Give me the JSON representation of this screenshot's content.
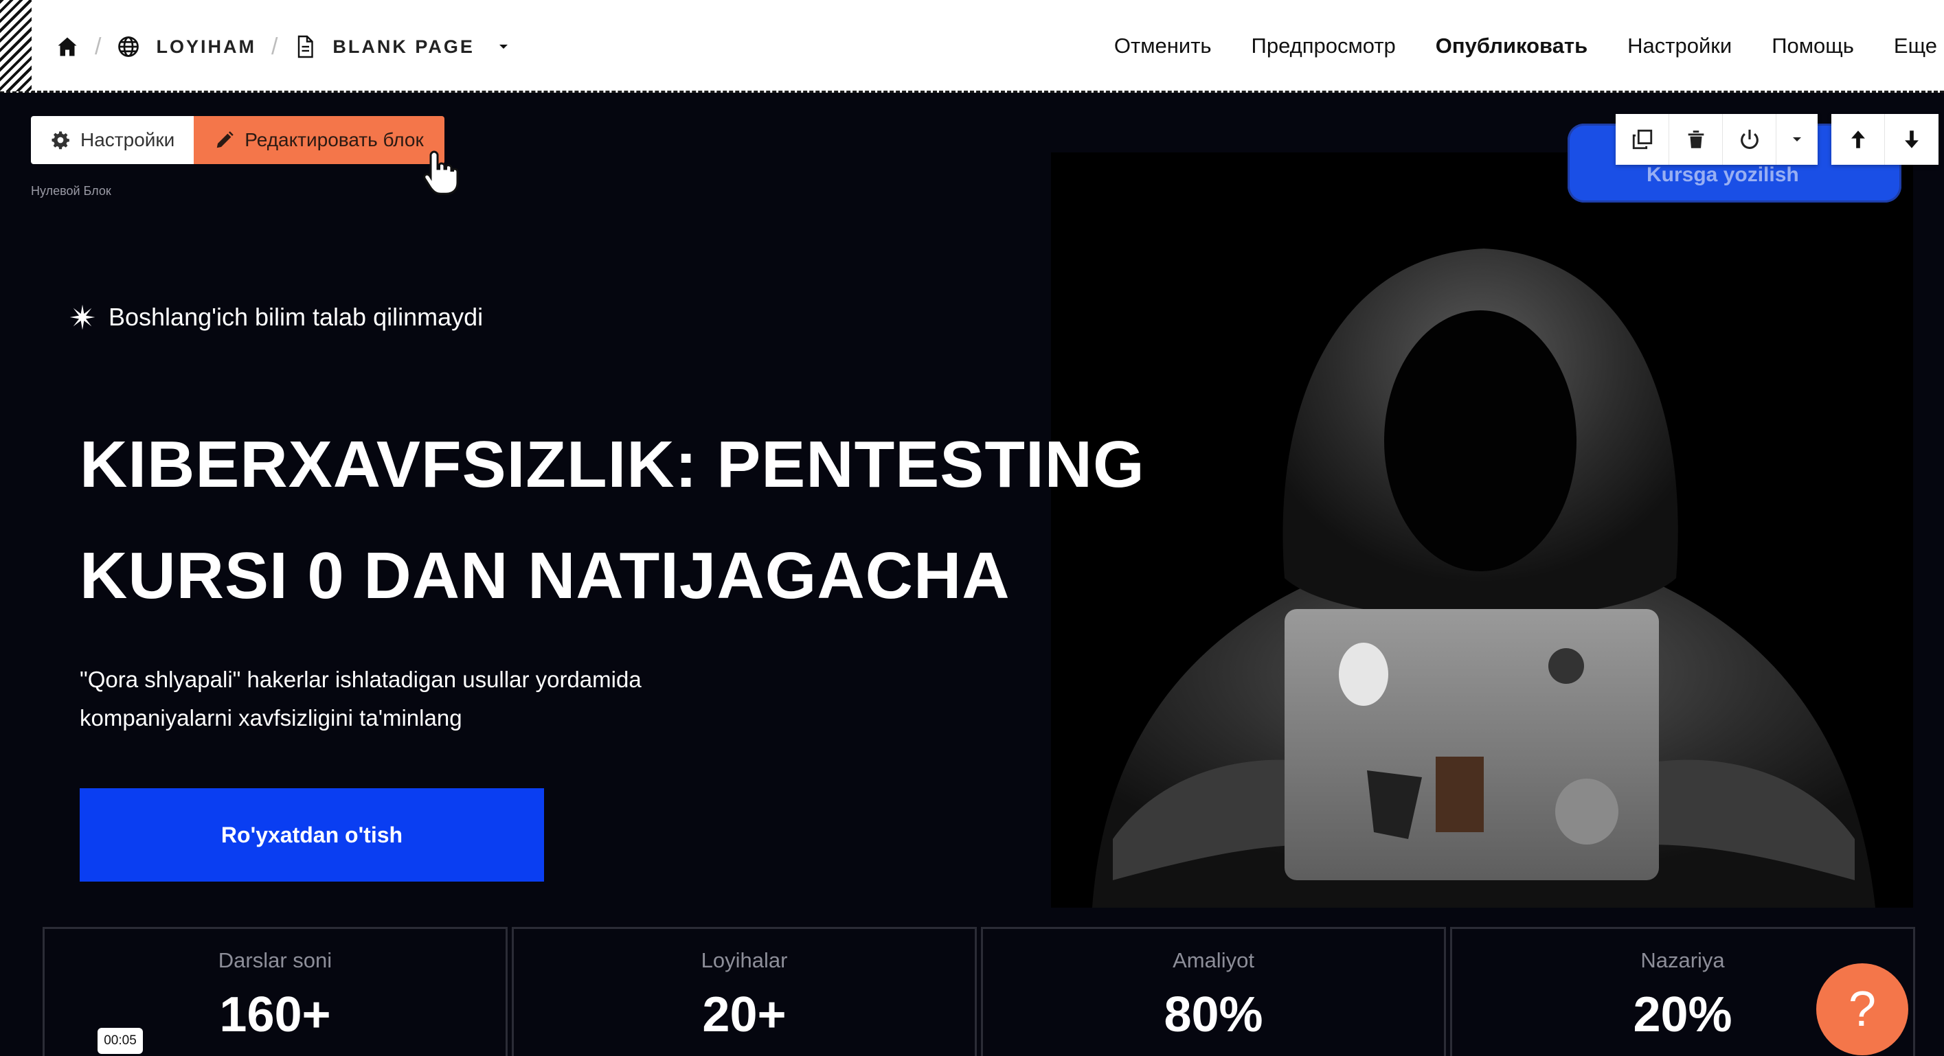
{
  "topbar": {
    "breadcrumb": {
      "home_icon": "home-icon",
      "project_icon": "globe-icon",
      "project": "LOYIHAM",
      "page_icon": "document-icon",
      "page": "BLANK PAGE",
      "separator": "/"
    },
    "nav": {
      "cancel": "Отменить",
      "preview": "Предпросмотр",
      "publish": "Опубликовать",
      "settings": "Настройки",
      "help": "Помощь",
      "more": "Еще"
    }
  },
  "block_tools": {
    "settings_label": "Настройки",
    "edit_label": "Редактировать блок",
    "caption": "Нулевой Блок"
  },
  "block_toolbar": {
    "icons": [
      "duplicate-icon",
      "trash-icon",
      "power-icon",
      "dropdown-icon",
      "arrow-up-icon",
      "arrow-down-icon"
    ],
    "ghost_button_label": "Kursga yozilish"
  },
  "hero": {
    "tagline": "Boshlang'ich bilim talab qilinmaydi",
    "headline_line1": "KIBERXAVFSIZLIK: PENTESTING",
    "headline_line2": "KURSI 0 DAN NATIJAGACHA",
    "subtext_line1": "\"Qora shlyapali\" hakerlar ishlatadigan usullar yordamida",
    "subtext_line2": "kompaniyalarni xavfsizligini ta'minlang",
    "cta_label": "Ro'yxatdan o'tish"
  },
  "stats": [
    {
      "label": "Darslar soni",
      "value": "160+"
    },
    {
      "label": "Loyihalar",
      "value": "20+"
    },
    {
      "label": "Amaliyot",
      "value": "80%"
    },
    {
      "label": "Nazariya",
      "value": "20%"
    }
  ],
  "video_timer": "00:05",
  "help_symbol": "?",
  "colors": {
    "accent_orange": "#f4764a",
    "cta_blue": "#0a3ef2",
    "background": "#05060f"
  }
}
